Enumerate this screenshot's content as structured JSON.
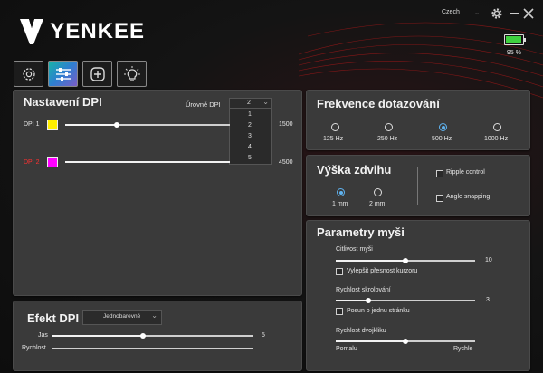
{
  "app": {
    "logo_text": "YENKEE"
  },
  "window": {
    "language": "Czech",
    "battery_percent": "95 %",
    "battery_level": 0.95
  },
  "toolbar": {
    "icons": [
      "gear-icon",
      "sliders-icon",
      "plus-icon",
      "bulb-icon"
    ],
    "active_index": 1
  },
  "dpi": {
    "title": "Nastavení DPI",
    "levels_label": "Úrovně DPI",
    "levels_value": "2",
    "levels_options": [
      "1",
      "2",
      "3",
      "4",
      "5"
    ],
    "rows": [
      {
        "label": "DPI 1",
        "color": "#ffee00",
        "value": "1500",
        "label_color": "#e6e6e6"
      },
      {
        "label": "DPI 2",
        "color": "#ff00ff",
        "value": "4500",
        "label_color": "#ff3030"
      }
    ]
  },
  "polling": {
    "title": "Frekvence dotazování",
    "options": [
      "125 Hz",
      "250 Hz",
      "500 Hz",
      "1000 Hz"
    ],
    "selected": "500 Hz"
  },
  "lift": {
    "title": "Výška zdvihu",
    "options": [
      "1 mm",
      "2 mm"
    ],
    "selected": "1 mm",
    "ripple_label": "Ripple control",
    "angle_label": "Angle snapping"
  },
  "mouse": {
    "title": "Parametry myši",
    "sensitivity_label": "Citlivost myši",
    "sensitivity_value": "10",
    "precision_label": "Vylepšit přesnost kurzoru",
    "scroll_label": "Rychlost skrolování",
    "scroll_value": "3",
    "page_scroll_label": "Posun o jednu stránku",
    "dblclick_label": "Rychlost dvojkliku",
    "slow_label": "Pomalu",
    "fast_label": "Rychle"
  },
  "effect": {
    "title": "Efekt DPI",
    "mode": "Jednobarevné",
    "brightness_label": "Jas",
    "brightness_value": "5",
    "speed_label": "Rychlost"
  }
}
